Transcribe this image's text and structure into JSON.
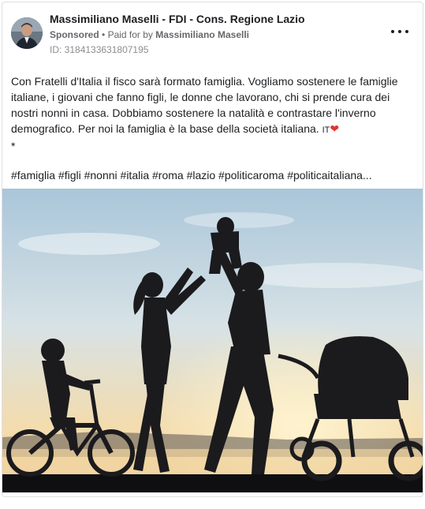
{
  "post": {
    "page_name": "Massimiliano Maselli - FDI - Cons. Regione Lazio",
    "sponsored_label": "Sponsored",
    "separator": "•",
    "paid_for_prefix": "Paid for by",
    "payer": "Massimiliano Maselli",
    "ad_id": "ID: 3184133631807195",
    "more_icon": "more-horizontal-icon",
    "body_line": "Con Fratelli d'Italia il fisco sarà formato famiglia. Vogliamo sostenere le famiglie italiane, i giovani che fanno figli, le donne che lavorano, chi si prende cura dei nostri nonni in casa. Dobbiamo sostenere la natalità e contrastare l'inverno demografico. Per noi la famiglia è la base della società italiana.",
    "flag_text": "IT",
    "heart_glyph": "❤",
    "asterisk": "*",
    "hashtags": "#famiglia #figli #nonni #italia #roma #lazio #politicaroma #politicaitaliana..."
  },
  "image": {
    "subject": "family-silhouette-at-sunset",
    "colors": {
      "sky_top": "#a9c6d9",
      "sky_mid": "#d7e2e6",
      "sunset": "#f6d69e",
      "sun": "#ffe7b0",
      "silhouette": "#1b1a1d",
      "ground": "#0f0f12"
    }
  }
}
